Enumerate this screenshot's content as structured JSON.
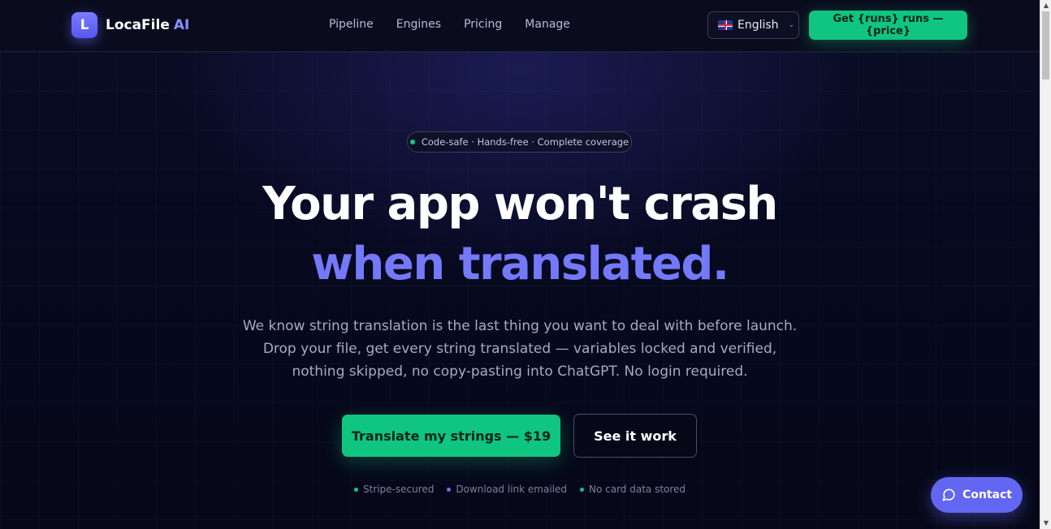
{
  "header": {
    "logo_letter": "L",
    "brand_name": "LocaFile",
    "brand_suffix": "AI",
    "nav": [
      "Pipeline",
      "Engines",
      "Pricing",
      "Manage"
    ],
    "language": "English",
    "cta_label": "Get {runs} runs — {price}"
  },
  "hero": {
    "pill_text": "Code-safe · Hands-free · Complete coverage",
    "headline_line1": "Your app won't crash",
    "headline_line2": "when translated.",
    "subtext": "We know string translation is the last thing you want to deal with before launch. Drop your file, get every string translated — variables locked and verified, nothing skipped, no copy-pasting into ChatGPT. No login required.",
    "primary_button": "Translate my strings — $19",
    "secondary_button": "See it work",
    "trust_items": [
      "Stripe-secured",
      "Download link emailed",
      "No card data stored"
    ]
  },
  "contact_button": "Contact",
  "colors": {
    "accent_green": "#10c57f",
    "accent_indigo": "#6366f1",
    "headline_accent": "#7479f9",
    "background": "#060818"
  }
}
